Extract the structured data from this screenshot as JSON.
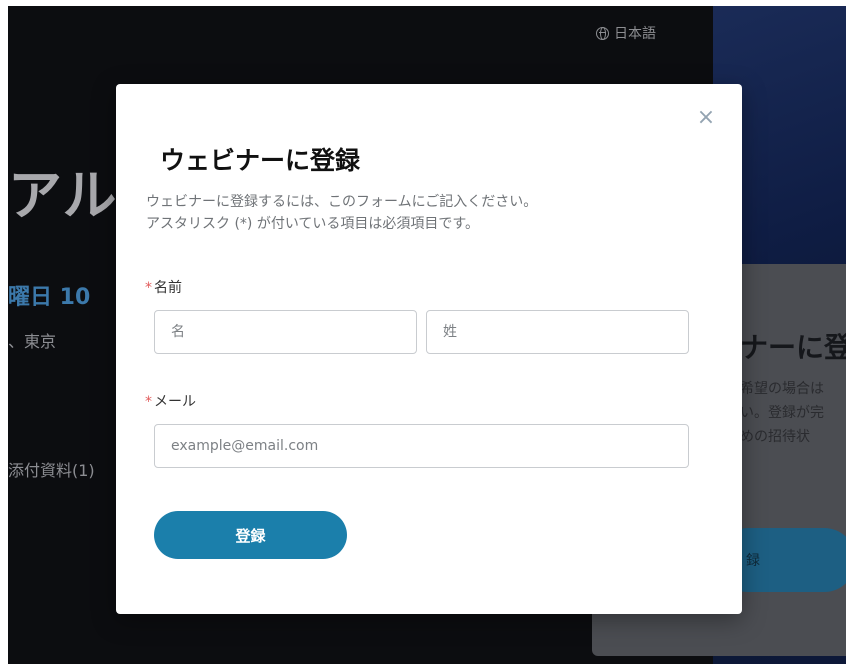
{
  "page": {
    "language_label": "日本語",
    "bg_title": "アル",
    "bg_date": "曜日 10",
    "bg_location": "、東京",
    "bg_attachments": "添付資料(1)"
  },
  "side_card": {
    "title": "ナーに登",
    "text_lines": [
      "希望の場合は",
      "い。登録が完",
      "めの招待状"
    ],
    "button_label": "録"
  },
  "modal": {
    "title": "ウェビナーに登録",
    "description_line1": "ウェビナーに登録するには、このフォームにご記入ください。",
    "description_line2": "アスタリスク (*) が付いている項目は必須項目です。",
    "required_mark": "*",
    "name_label": "名前",
    "first_name_placeholder": "名",
    "last_name_placeholder": "姓",
    "email_label": "メール",
    "email_placeholder": "example@email.com",
    "submit_label": "登録"
  },
  "colors": {
    "accent": "#1b7fab",
    "required": "#e15b5b",
    "overlay_bg": "#0c0d10"
  },
  "icons": {
    "language": "globe-icon",
    "close": "close-icon"
  }
}
